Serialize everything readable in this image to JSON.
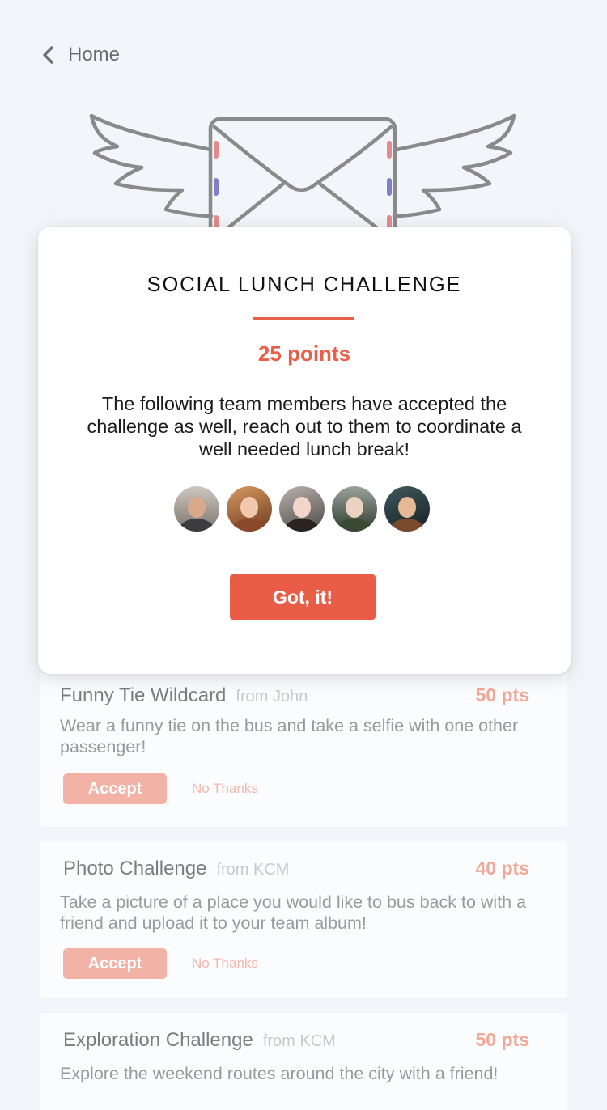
{
  "nav": {
    "back_label": "Home"
  },
  "modal": {
    "title": "SOCIAL LUNCH CHALLENGE",
    "points": "25 points",
    "message": "The following team members have accepted the challenge as well, reach out to them to coordinate a well needed lunch break!",
    "button_label": "Got, it!",
    "accent_color": "#e95d47"
  },
  "challenges": [
    {
      "title": "Funny Tie Wildcard",
      "from": "from John",
      "points": "50 pts",
      "description": "Wear a funny tie on the bus and take a selfie with one other passenger!",
      "accept_label": "Accept",
      "decline_label": "No Thanks"
    },
    {
      "title": "Photo Challenge",
      "from": "from KCM",
      "points": "40 pts",
      "description": "Take a picture of a place you would like to bus back to with a friend and upload it to your team album!",
      "accept_label": "Accept",
      "decline_label": "No Thanks"
    },
    {
      "title": "Exploration Challenge",
      "from": "from KCM",
      "points": "50 pts",
      "description": "Explore the weekend routes around the city with a friend!"
    }
  ]
}
